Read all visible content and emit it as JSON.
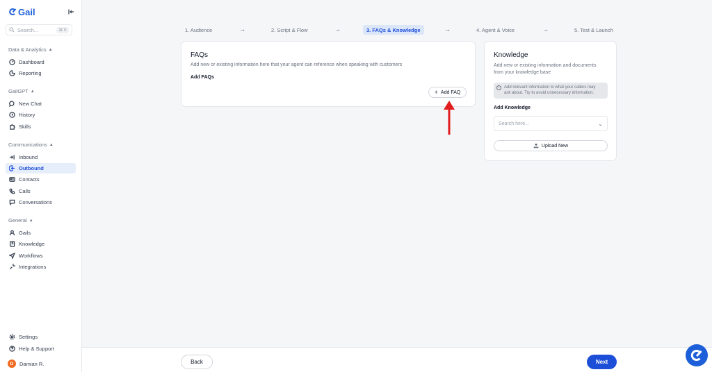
{
  "brand": {
    "name": "Gail",
    "color": "#1d5fd8"
  },
  "sidebar": {
    "search": {
      "placeholder": "Search...",
      "shortcut": "⌘ K"
    },
    "sections": {
      "data_analytics": "Data & Analytics",
      "gailgpt": "GailGPT",
      "communications": "Communications",
      "general": "General"
    },
    "items": {
      "dashboard": "Dashboard",
      "reporting": "Reporting",
      "new_chat": "New Chat",
      "history": "History",
      "skills": "Skills",
      "inbound": "Inbound",
      "outbound": "Outbound",
      "contacts": "Contacts",
      "calls": "Calls",
      "conversations": "Conversations",
      "gails": "Gails",
      "knowledge": "Knowledge",
      "workflows": "Workflows",
      "integrations": "Integrations",
      "settings": "Settings",
      "help_support": "Help & Support"
    },
    "user": {
      "initial": "D",
      "name": "Damian R."
    }
  },
  "stepper": {
    "steps": [
      "1. Audience",
      "2. Script & Flow",
      "3. FAQs & Knowledge",
      "4. Agent & Voice",
      "5. Test & Launch"
    ],
    "active_index": 2
  },
  "faqs": {
    "title": "FAQs",
    "description": "Add new or existing information here that your agent can reference when speaking with customers",
    "subtitle": "Add FAQs",
    "add_button": "Add FAQ"
  },
  "knowledge": {
    "title": "Knowledge",
    "description_line1": "Add new or existing information and documents",
    "description_line2": "from your knowledge base",
    "info_line1": "Add relevant information to what your callers may",
    "info_line2": "ask about. Try to avoid unnecessary information.",
    "subtitle": "Add Knowledge",
    "search_placeholder": "Search here...",
    "upload_button": "Upload New"
  },
  "footer": {
    "back": "Back",
    "next": "Next"
  },
  "colors": {
    "accent": "#1d4ed8",
    "annotation": "#e11d1d",
    "avatar": "#f26b21"
  }
}
